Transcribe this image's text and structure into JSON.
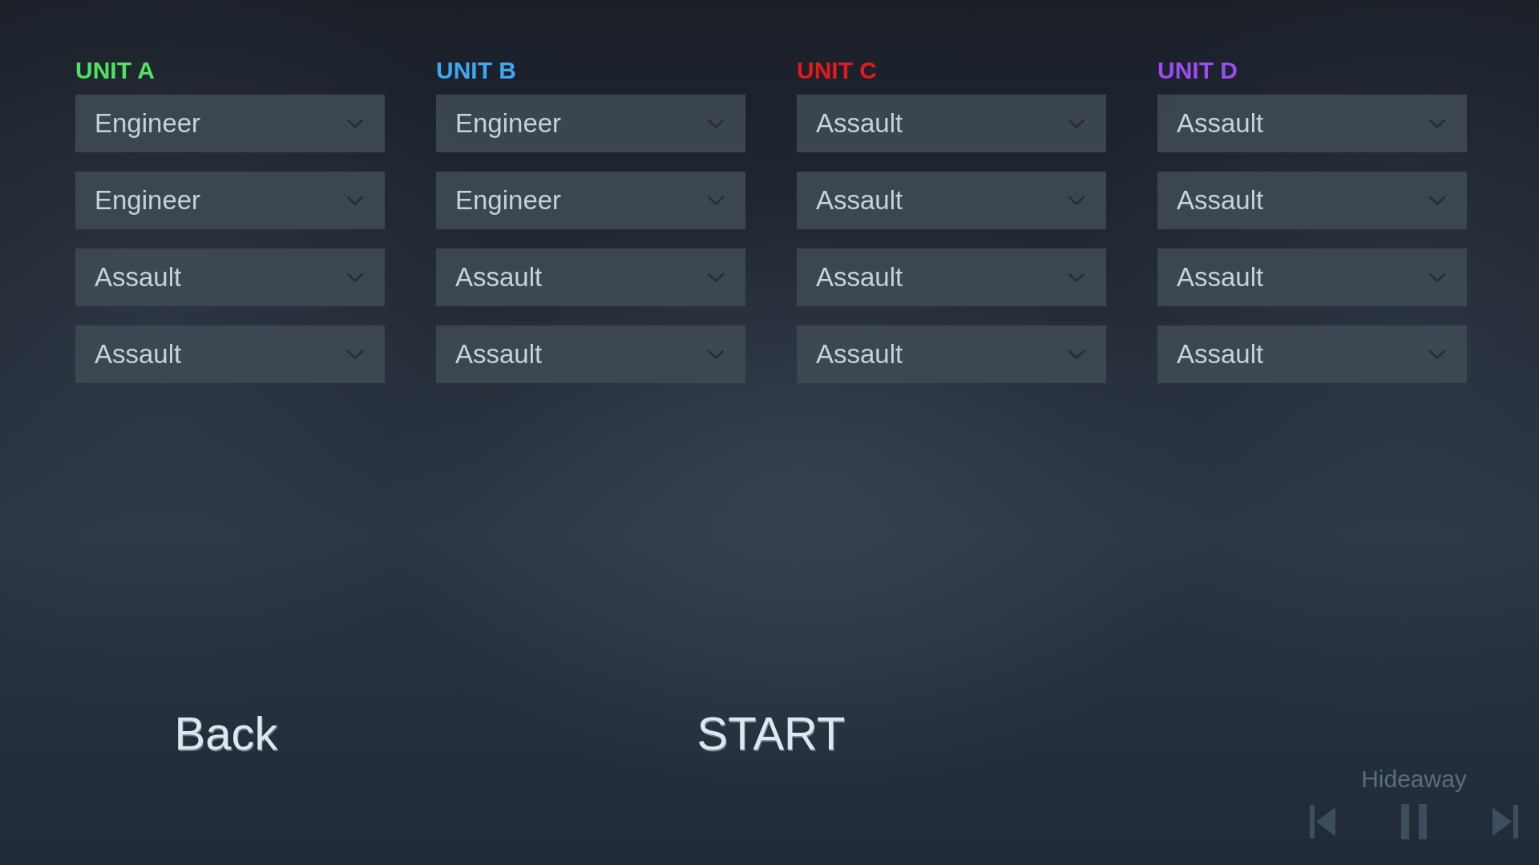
{
  "units": [
    {
      "title": "UNIT A",
      "color": "#4fe35f",
      "slots": [
        "Engineer",
        "Engineer",
        "Assault",
        "Assault"
      ]
    },
    {
      "title": "UNIT B",
      "color": "#3ea9f2",
      "slots": [
        "Engineer",
        "Engineer",
        "Assault",
        "Assault"
      ]
    },
    {
      "title": "UNIT C",
      "color": "#e8191d",
      "slots": [
        "Assault",
        "Assault",
        "Assault",
        "Assault"
      ]
    },
    {
      "title": "UNIT D",
      "color": "#9b4cf2",
      "slots": [
        "Assault",
        "Assault",
        "Assault",
        "Assault"
      ]
    }
  ],
  "back_button": "Back",
  "start_button": "START",
  "music_player": {
    "track": "Hideaway",
    "playing": true
  }
}
